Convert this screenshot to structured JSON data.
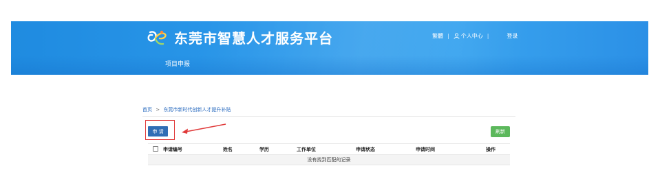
{
  "site": {
    "title": "东莞市智慧人才服务平台",
    "top_links": {
      "traditional": "繁體",
      "user_center": "个人中心",
      "login": "登录"
    },
    "nav": {
      "project_apply": "项目申报"
    }
  },
  "breadcrumb": {
    "home": "首页",
    "separator": ">",
    "current": "东莞市新时代创新人才提升补贴"
  },
  "toolbar": {
    "apply_label": "申 请",
    "refresh_label": "刷新"
  },
  "table": {
    "columns": [
      "申请编号",
      "姓名",
      "学历",
      "工作单位",
      "申请状态",
      "申请时间",
      "操作"
    ],
    "empty_message": "没有找到匹配的记录"
  },
  "colors": {
    "banner": "#2b98ea",
    "apply_button": "#2f6eb5",
    "refresh_button": "#5cb85c",
    "highlight": "#e03a3a"
  }
}
